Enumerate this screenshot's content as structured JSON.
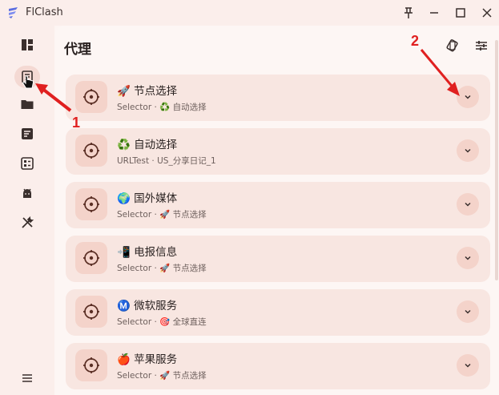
{
  "window": {
    "title": "FlClash"
  },
  "page": {
    "title": "代理"
  },
  "groups": [
    {
      "name": "🚀 节点选择",
      "type": "Selector",
      "current": "♻️ 自动选择"
    },
    {
      "name": "♻️ 自动选择",
      "type": "URLTest",
      "current": "US_分享日记_1"
    },
    {
      "name": "🌍 国外媒体",
      "type": "Selector",
      "current": "🚀 节点选择"
    },
    {
      "name": "📲 电报信息",
      "type": "Selector",
      "current": "🚀 节点选择"
    },
    {
      "name": "Ⓜ️ 微软服务",
      "type": "Selector",
      "current": "🎯 全球直连"
    },
    {
      "name": "🍎 苹果服务",
      "type": "Selector",
      "current": "🚀 节点选择"
    }
  ],
  "separator": "·",
  "annotations": {
    "marker_1": "1",
    "marker_2": "2"
  },
  "icons": {
    "sidebar": [
      "dashboard-icon",
      "proxies-icon",
      "profiles-icon",
      "requests-icon",
      "connections-icon",
      "resources-icon",
      "tools-icon"
    ],
    "menu": "menu-icon",
    "top": [
      "layout-icon",
      "tune-icon"
    ]
  },
  "colors": {
    "accent": "#a6422f",
    "card": "#f8e6e1",
    "annotation": "#e02020"
  }
}
